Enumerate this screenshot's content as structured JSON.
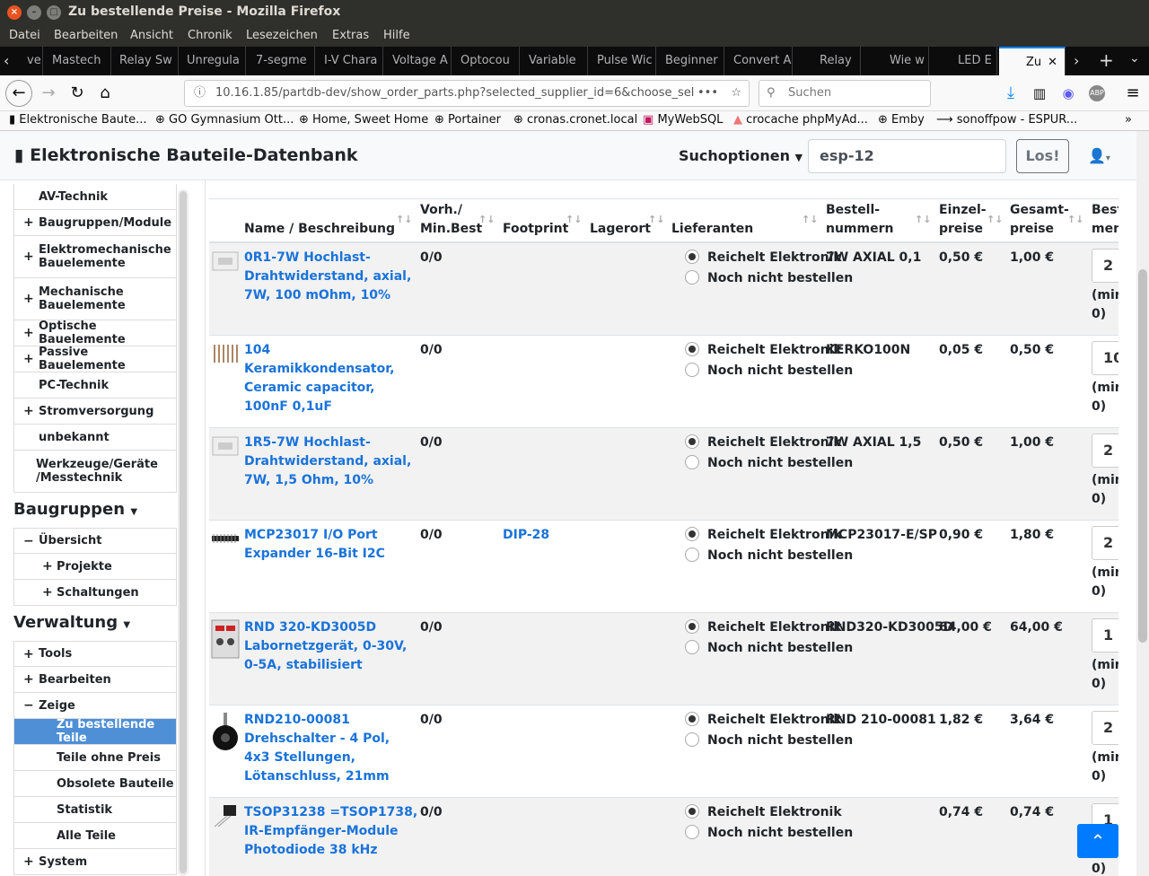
{
  "window": {
    "title": "Zu bestellende Preise - Mozilla Firefox"
  },
  "menu": [
    "Datei",
    "Bearbeiten",
    "Ansicht",
    "Chronik",
    "Lesezeichen",
    "Extras",
    "Hilfe"
  ],
  "tabs": [
    "ve",
    "Mastech",
    "Relay Sw",
    "Unregula",
    "7-segme",
    "I-V Chara",
    "Voltage A",
    "Optocou",
    "Variable",
    "Pulse Wic",
    "Beginner",
    "Convert A",
    "Relay",
    "Wie w",
    "LED E",
    "Zu"
  ],
  "url": "10.16.1.85/partdb-dev/show_order_parts.php?selected_supplier_id=6&choose_select",
  "search_placeholder": "Suchen",
  "bookmarks": [
    "Elektronische Baute...",
    "GO Gymnasium Ott...",
    "Home, Sweet Home",
    "Portainer",
    "cronas.cronet.local",
    "MyWebSQL",
    "crocache phpMyAd...",
    "Emby",
    "sonoffpow - ESPUR..."
  ],
  "app": {
    "brand": "Elektronische Bauteile-Datenbank",
    "search_options": "Suchoptionen",
    "search_value": "esp-12",
    "go_button": "Los!"
  },
  "sidebar": {
    "categories": [
      {
        "label": "AV-Technik",
        "plus": false
      },
      {
        "label": "Baugruppen/Module",
        "plus": true
      },
      {
        "label": "Elektromechanische Bauelemente",
        "plus": true
      },
      {
        "label": "Mechanische Bauelemente",
        "plus": true
      },
      {
        "label": "Optische Bauelemente",
        "plus": true
      },
      {
        "label": "Passive Bauelemente",
        "plus": true
      },
      {
        "label": "PC-Technik",
        "plus": false
      },
      {
        "label": "Stromversorgung",
        "plus": true
      },
      {
        "label": "unbekannt",
        "plus": false
      },
      {
        "label": "Werkzeuge/Geräte /Messtechnik",
        "plus": false
      }
    ],
    "baugruppen_heading": "Baugruppen",
    "baugruppen": [
      "Übersicht",
      "Projekte",
      "Schaltungen"
    ],
    "verwaltung_heading": "Verwaltung",
    "verwaltung": [
      "Tools",
      "Bearbeiten",
      "Zeige",
      "Zu bestellende Teile",
      "Teile ohne Preis",
      "Obsolete Bauteile",
      "Statistik",
      "Alle Teile",
      "System"
    ]
  },
  "table": {
    "headers": {
      "name": "Name / Beschreibung",
      "stock1": "Vorh./",
      "stock2": "Min.Best",
      "footprint": "Footprint",
      "location": "Lagerort",
      "suppliers": "Lieferanten",
      "ordernr1": "Bestell-",
      "ordernr2": "nummern",
      "price1": "Einzel-",
      "price2": "preise",
      "total1": "Gesamt-",
      "total2": "preise",
      "qty1": "Best",
      "qty2": "menge"
    },
    "supplier_option": "Reichelt Elektronik",
    "no_order_option": "Noch nicht bestellen",
    "min_label1": "(min",
    "min_label2": "0)",
    "rows": [
      {
        "name": "0R1-7W Hochlast-Drahtwiderstand, axial, 7W, 100 mOhm, 10%",
        "stock": "0/0",
        "footprint": "",
        "ordernr": "7W AXIAL 0,1",
        "price": "0,50 €",
        "total": "1,00 €",
        "qty": "2",
        "thumb": "resistor"
      },
      {
        "name": "104 Keramikkondensator, Ceramic capacitor, 100nF 0,1uF",
        "stock": "0/0",
        "footprint": "",
        "ordernr": "KERKO100N",
        "price": "0,05 €",
        "total": "0,50 €",
        "qty": "10",
        "thumb": "capacitor"
      },
      {
        "name": "1R5-7W Hochlast-Drahtwiderstand, axial, 7W, 1,5 Ohm, 10%",
        "stock": "0/0",
        "footprint": "",
        "ordernr": "7W AXIAL 1,5",
        "price": "0,50 €",
        "total": "1,00 €",
        "qty": "2",
        "thumb": "resistor"
      },
      {
        "name": "MCP23017 I/O Port Expander 16-Bit I2C",
        "stock": "0/0",
        "footprint": "DIP-28",
        "ordernr": "MCP23017-E/SP",
        "price": "0,90 €",
        "total": "1,80 €",
        "qty": "2",
        "thumb": "chip"
      },
      {
        "name": "RND 320-KD3005D Labornetzgerät, 0-30V, 0-5A, stabilisiert",
        "stock": "0/0",
        "footprint": "",
        "ordernr": "RND320-KD3005D",
        "price": "64,00 €",
        "total": "64,00 €",
        "qty": "1",
        "thumb": "psu"
      },
      {
        "name": "RND210-00081 Drehschalter - 4 Pol, 4x3 Stellungen, Lötanschluss, 21mm",
        "stock": "0/0",
        "footprint": "",
        "ordernr": "RND 210-00081",
        "price": "1,82 €",
        "total": "3,64 €",
        "qty": "2",
        "thumb": "knob"
      },
      {
        "name": "TSOP31238 =TSOP1738, IR-Empfänger-Module Photodiode 38 kHz",
        "stock": "0/0",
        "footprint": "",
        "ordernr": "",
        "price": "0,74 €",
        "total": "0,74 €",
        "qty": "1",
        "thumb": "ir"
      }
    ]
  }
}
